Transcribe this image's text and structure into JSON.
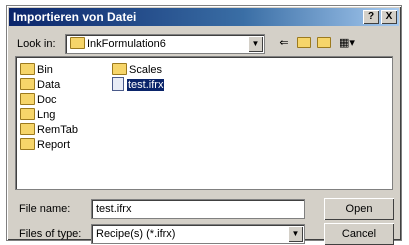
{
  "window": {
    "title": "Importieren von Datei"
  },
  "titlebar_buttons": {
    "help": "?",
    "close": "X"
  },
  "lookin": {
    "label": "Look in:",
    "value": "InkFormulation6"
  },
  "toolbar": {
    "back_icon": "back-arrow-icon",
    "up_icon": "up-folder-icon",
    "new_folder_icon": "new-folder-icon",
    "view_icon": "view-menu-icon"
  },
  "files": [
    {
      "name": "Bin",
      "type": "folder"
    },
    {
      "name": "Data",
      "type": "folder"
    },
    {
      "name": "Doc",
      "type": "folder"
    },
    {
      "name": "Lng",
      "type": "folder"
    },
    {
      "name": "RemTab",
      "type": "folder"
    },
    {
      "name": "Report",
      "type": "folder"
    },
    {
      "name": "Scales",
      "type": "folder"
    },
    {
      "name": "test.ifrx",
      "type": "file",
      "selected": true
    }
  ],
  "filename": {
    "label": "File name:",
    "value": "test.ifrx"
  },
  "filetype": {
    "label": "Files of type:",
    "value": "Recipe(s) (*.ifrx)"
  },
  "buttons": {
    "open": "Open",
    "cancel": "Cancel"
  }
}
